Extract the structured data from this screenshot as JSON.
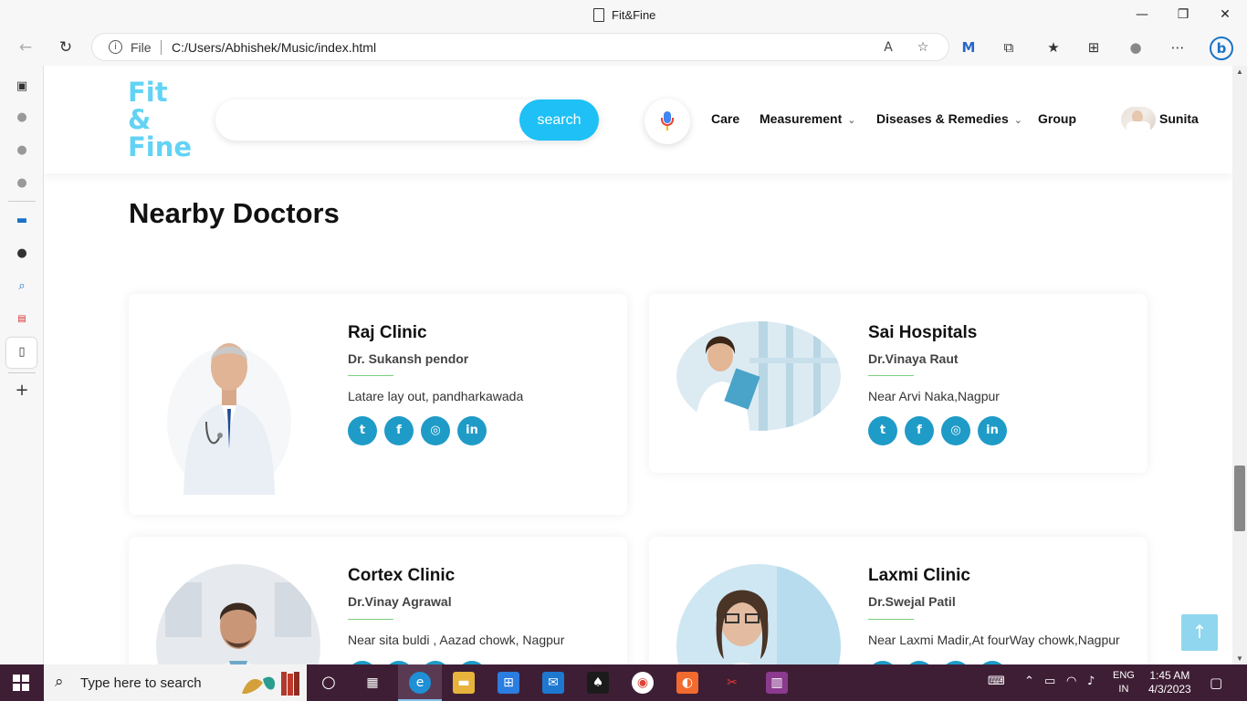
{
  "window": {
    "title": "Fit&Fine"
  },
  "browser": {
    "url_label": "File",
    "url": "C:/Users/Abhishek/Music/index.html"
  },
  "header": {
    "logo": [
      "Fit",
      "&",
      "Fine"
    ],
    "search_placeholder": "",
    "search_button": "search",
    "nav": [
      {
        "label": "Care",
        "dropdown": false
      },
      {
        "label": "Measurement",
        "dropdown": true
      },
      {
        "label": "Diseases & Remedies",
        "dropdown": true
      },
      {
        "label": "Group",
        "dropdown": false
      }
    ],
    "user": "Sunita"
  },
  "section": {
    "title": "Nearby Doctors"
  },
  "doctors": [
    {
      "clinic": "Raj Clinic",
      "doctor": "Dr. Sukansh pendor",
      "address": "Latare lay out, pandharkawada",
      "social": [
        "twitter-icon",
        "facebook-icon",
        "instagram-icon",
        "linkedin-icon"
      ]
    },
    {
      "clinic": "Sai Hospitals",
      "doctor": "Dr.Vinaya Raut",
      "address": "Near Arvi Naka,Nagpur",
      "social": [
        "twitter-icon",
        "facebook-icon",
        "instagram-icon",
        "linkedin-icon"
      ]
    },
    {
      "clinic": "Cortex Clinic",
      "doctor": "Dr.Vinay Agrawal",
      "address": "Near sita buldi , Aazad chowk, Nagpur",
      "social": [
        "twitter-icon",
        "facebook-icon",
        "instagram-icon",
        "linkedin-icon"
      ]
    },
    {
      "clinic": "Laxmi Clinic",
      "doctor": "Dr.Swejal Patil",
      "address": "Near Laxmi Madir,At fourWay chowk,Nagpur",
      "social": [
        "twitter-icon",
        "facebook-icon",
        "instagram-icon",
        "linkedin-icon"
      ]
    }
  ],
  "taskbar": {
    "search_placeholder": "Type here to search",
    "lang_top": "ENG",
    "lang_bottom": "IN",
    "time": "1:45 AM",
    "date": "4/3/2023"
  },
  "colors": {
    "logo": "#62d3f5",
    "search_button": "#1ec0f5",
    "social": "#1f9bc7",
    "accent_rule": "#7dd17f",
    "taskbar": "#3e1e35"
  }
}
